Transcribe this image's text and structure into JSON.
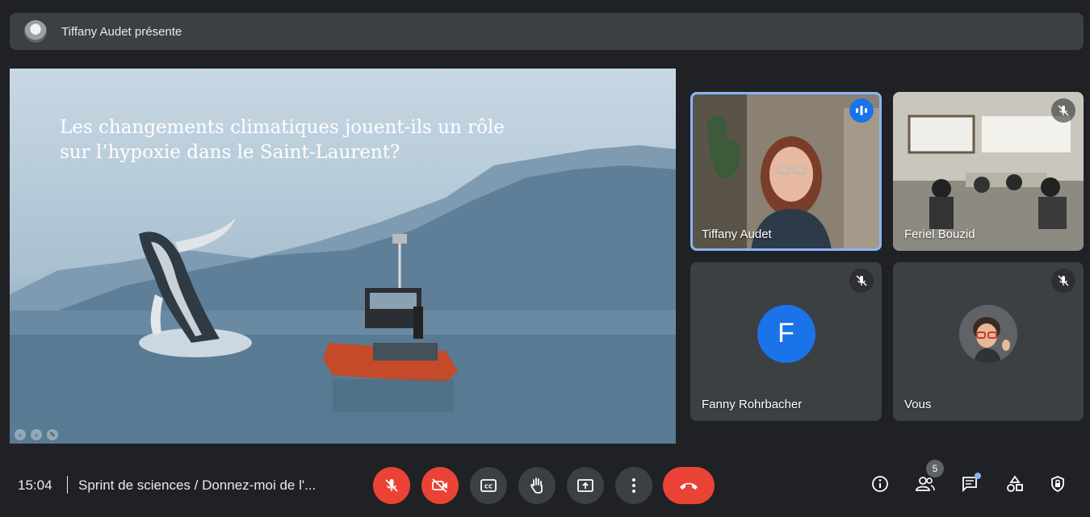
{
  "presenting_bar": {
    "text": "Tiffany Audet présente"
  },
  "slide": {
    "title_line1": "Les changements climatiques jouent-ils un rôle",
    "title_line2": "sur l’hypoxie dans le Saint-Laurent?"
  },
  "participants": [
    {
      "name": "Tiffany Audet",
      "status": "speaking"
    },
    {
      "name": "Feriel Bouzid",
      "status": "muted"
    },
    {
      "name": "Fanny Rohrbacher",
      "status": "muted",
      "initial": "F",
      "avatar_color": "#1a73e8"
    },
    {
      "name": "Vous",
      "status": "muted"
    }
  ],
  "bottom_bar": {
    "time": "15:04",
    "meeting_title": "Sprint de sciences / Donnez-moi de l'...",
    "people_count": "5"
  },
  "colors": {
    "hangup": "#ea4335",
    "accent": "#8ab4f8",
    "background": "#202124"
  },
  "icons": [
    "mic-off-icon",
    "camera-off-icon",
    "captions-icon",
    "raise-hand-icon",
    "present-icon",
    "more-icon",
    "hangup-icon",
    "info-icon",
    "people-icon",
    "chat-icon",
    "activities-icon",
    "host-controls-icon"
  ]
}
